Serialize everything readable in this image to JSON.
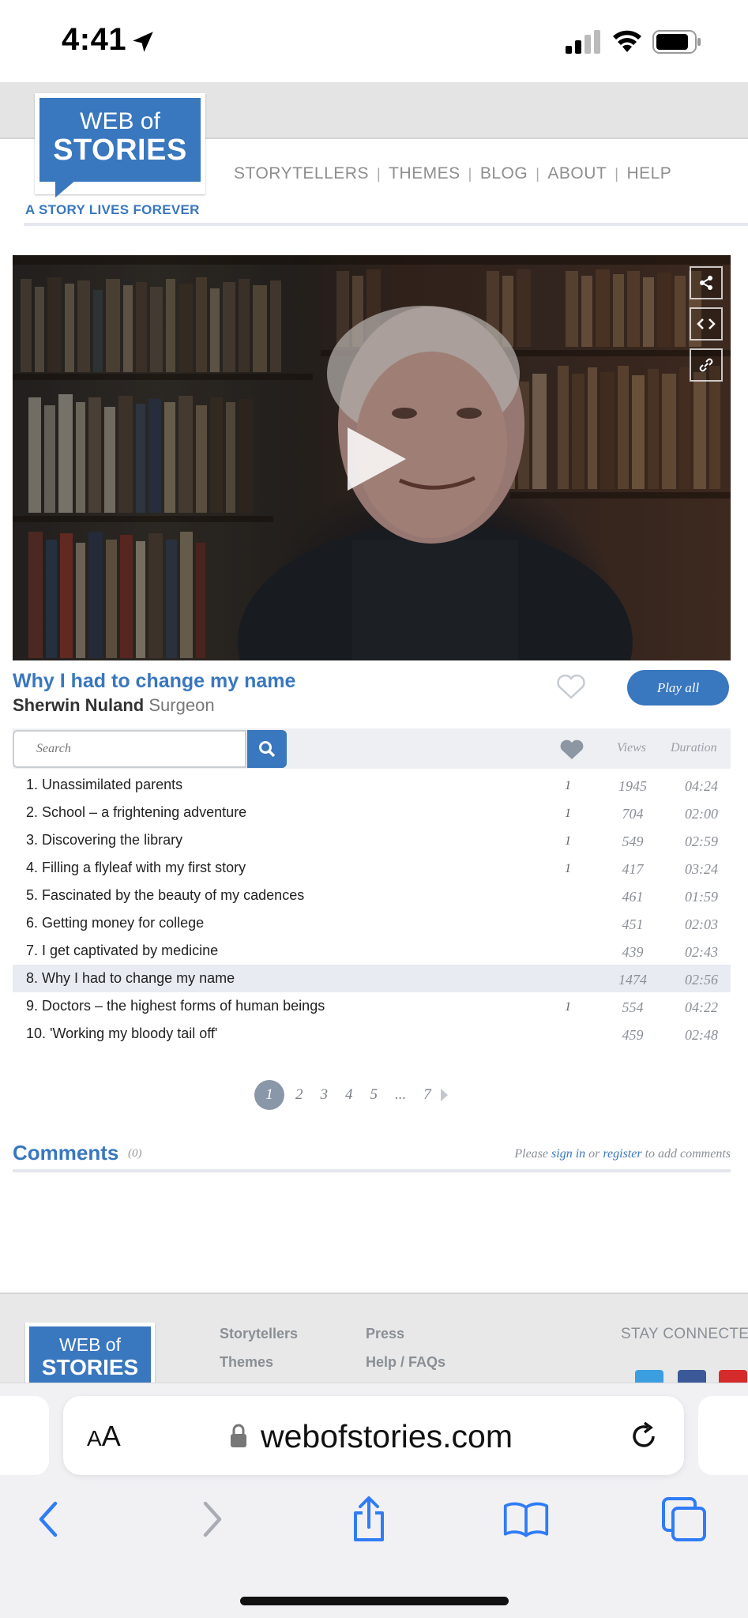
{
  "status_bar": {
    "time": "4:41"
  },
  "site": {
    "logo_line1": "WEB of",
    "logo_line2": "STORIES",
    "tagline": "A STORY LIVES FOREVER",
    "nav": [
      "STORYTELLERS",
      "THEMES",
      "BLOG",
      "ABOUT",
      "HELP"
    ]
  },
  "video": {
    "tools": [
      "share-icon",
      "embed-icon",
      "link-icon"
    ]
  },
  "story": {
    "title": "Why I had to change my name",
    "storyteller_name": "Sherwin Nuland",
    "storyteller_role": "Surgeon",
    "play_all_label": "Play all"
  },
  "playlist": {
    "search_placeholder": "Search",
    "col_views": "Views",
    "col_duration": "Duration",
    "active_index": 7,
    "rows": [
      {
        "title": "1. Unassimilated parents",
        "likes": "1",
        "views": "1945",
        "duration": "04:24"
      },
      {
        "title": "2. School – a frightening adventure",
        "likes": "1",
        "views": "704",
        "duration": "02:00"
      },
      {
        "title": "3. Discovering the library",
        "likes": "1",
        "views": "549",
        "duration": "02:59"
      },
      {
        "title": "4. Filling a flyleaf with my first story",
        "likes": "1",
        "views": "417",
        "duration": "03:24"
      },
      {
        "title": "5. Fascinated by the beauty of my cadences",
        "likes": "",
        "views": "461",
        "duration": "01:59"
      },
      {
        "title": "6. Getting money for college",
        "likes": "",
        "views": "451",
        "duration": "02:03"
      },
      {
        "title": "7. I get captivated by medicine",
        "likes": "",
        "views": "439",
        "duration": "02:43"
      },
      {
        "title": "8. Why I had to change my name",
        "likes": "",
        "views": "1474",
        "duration": "02:56"
      },
      {
        "title": "9. Doctors – the highest forms of human beings",
        "likes": "1",
        "views": "554",
        "duration": "04:22"
      },
      {
        "title": "10. 'Working my bloody tail off'",
        "likes": "",
        "views": "459",
        "duration": "02:48"
      }
    ],
    "pages": [
      "1",
      "2",
      "3",
      "4",
      "5",
      "...",
      "7"
    ],
    "current_page": "1"
  },
  "comments": {
    "heading": "Comments",
    "count": "(0)",
    "note_pre": "Please",
    "sign_in": "sign in",
    "note_or": "or",
    "register": "register",
    "note_post": "to add comments"
  },
  "footer": {
    "logo_line1": "WEB of",
    "logo_line2": "STORIES",
    "col1": [
      "Storytellers",
      "Themes"
    ],
    "col2": [
      "Press",
      "Help / FAQs"
    ],
    "stay_connected": "STAY CONNECTE"
  },
  "browser": {
    "text_size_label": "AA",
    "url": "webofstories.com"
  },
  "colors": {
    "brand_blue": "#3977be",
    "background": "#ffffff",
    "footer": "#e8e8e8"
  }
}
